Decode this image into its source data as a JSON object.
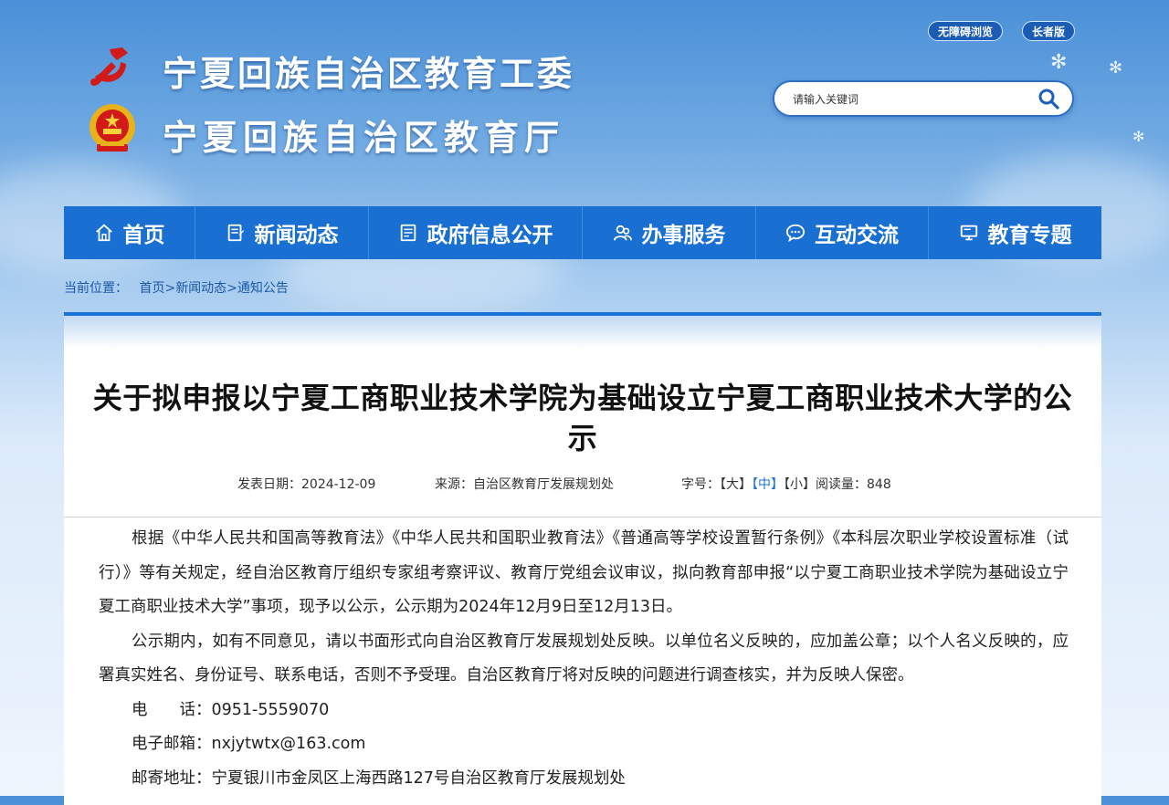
{
  "header": {
    "title_line1": "宁夏回族自治区教育工委",
    "title_line2": "宁夏回族自治区教育厅",
    "accessibility_label": "无障碍浏览",
    "elder_label": "长者版",
    "search_placeholder": "请输入关键词"
  },
  "nav": {
    "items": [
      {
        "label": "首页",
        "icon": "home-icon"
      },
      {
        "label": "新闻动态",
        "icon": "news-icon"
      },
      {
        "label": "政府信息公开",
        "icon": "document-icon"
      },
      {
        "label": "办事服务",
        "icon": "service-icon"
      },
      {
        "label": "互动交流",
        "icon": "chat-icon"
      },
      {
        "label": "教育专题",
        "icon": "monitor-icon"
      }
    ]
  },
  "breadcrumb": {
    "prefix": "当前位置：",
    "home": "首页",
    "sep1": ">",
    "news": "新闻动态",
    "sep2": ">",
    "notice": "通知公告"
  },
  "article": {
    "title_line1": "关于拟申报以宁夏工商职业技术学院为基础设立宁夏工商职业技术大学的公",
    "title_line2": "示",
    "date_text": "发表日期：2024-12-09",
    "source_text": "来源：自治区教育厅发展规划处",
    "font_label": "字号：",
    "font_large": "【大】",
    "font_medium": "【中】",
    "font_small": "【小】",
    "read_label": "阅读量：",
    "read_count": "848",
    "paragraphs": [
      "根据《中华人民共和国高等教育法》《中华人民共和国职业教育法》《普通高等学校设置暂行条例》《本科层次职业学校设置标准（试行）》等有关规定，经自治区教育厅组织专家组考察评议、教育厅党组会议审议，拟向教育部申报“以宁夏工商职业技术学院为基础设立宁夏工商职业技术大学”事项，现予以公示，公示期为2024年12月9日至12月13日。",
      "公示期内，如有不同意见，请以书面形式向自治区教育厅发展规划处反映。以单位名义反映的，应加盖公章；以个人名义反映的，应署真实姓名、身份证号、联系电话，否则不予受理。自治区教育厅将对反映的问题进行调查核实，并为反映人保密。",
      "电　　话：0951-5559070",
      "电子邮箱：nxjytwtx@163.com",
      "邮寄地址：宁夏银川市金凤区上海西路127号自治区教育厅发展规划处"
    ]
  },
  "colors": {
    "nav_bg": "#1a6fd2",
    "link_blue": "#1c58a6",
    "accent_red": "#d21a1a"
  }
}
